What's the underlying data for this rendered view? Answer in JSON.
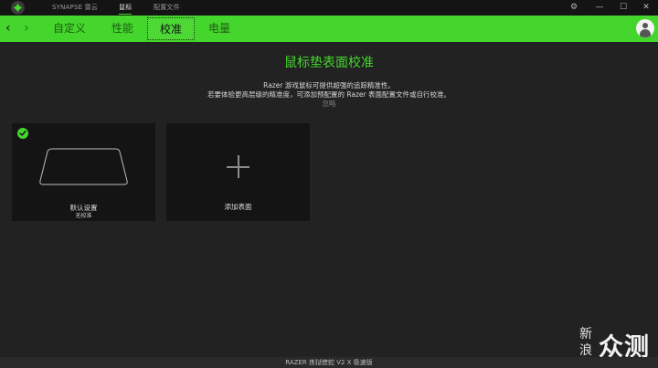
{
  "app": {
    "tabs": [
      "SYNAPSE 雷云",
      "鼠标",
      "配置文件"
    ],
    "active_tab": "鼠标"
  },
  "window_controls": {
    "settings": "⚙",
    "minimize": "—",
    "maximize": "☐",
    "close": "✕"
  },
  "nav": {
    "back_icon": "‹",
    "forward_icon": "›",
    "tabs": [
      "自定义",
      "性能",
      "校准",
      "电量"
    ],
    "active_tab": "校准"
  },
  "main": {
    "title": "鼠标垫表面校准",
    "description_line1": "Razer 游戏鼠标可提供超强的追踪精准性。",
    "description_line2": "若要体验更高层级的精准度，可添加预配置的 Razer 表面配置文件或自行校准。",
    "ignore_link": "忽略"
  },
  "cards": [
    {
      "label": "默认设置",
      "sublabel": "无校准",
      "selected": true
    },
    {
      "label": "添加表面",
      "sublabel": ""
    }
  ],
  "watermark": {
    "mark_top": "新",
    "mark_bottom": "浪",
    "text": "众测"
  },
  "footer": {
    "device": "RAZER 炼狱蝰蛇 V2 X 极速版"
  },
  "colors": {
    "accent": "#44d62c",
    "background": "#222222",
    "titlebar": "#141414"
  }
}
